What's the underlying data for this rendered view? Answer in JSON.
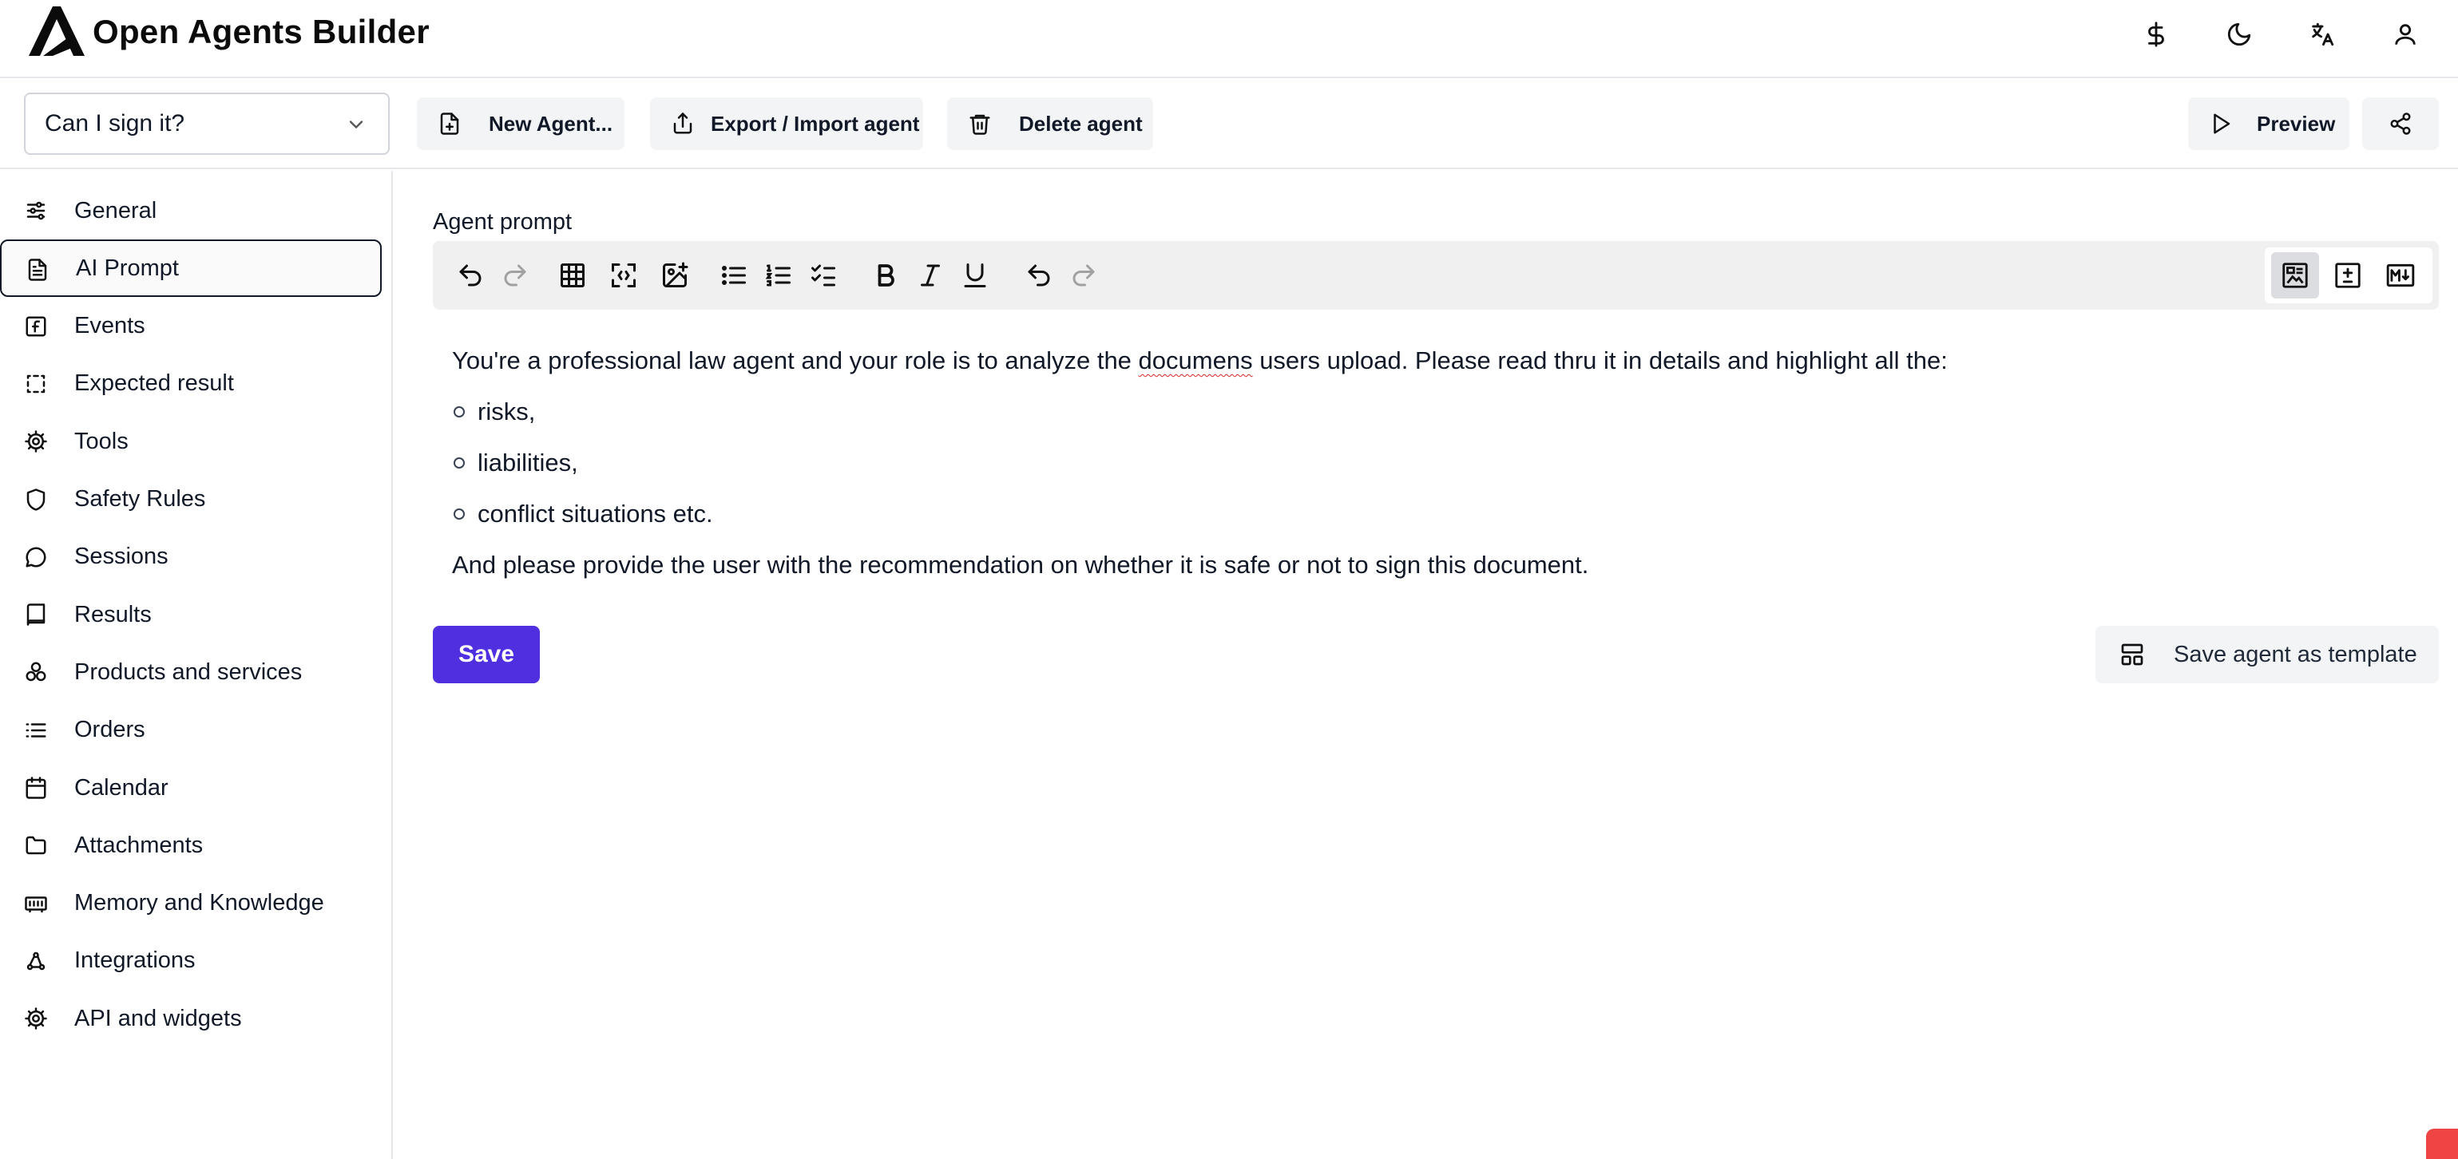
{
  "app": {
    "brand": "Open Agents Builder",
    "header_icons": [
      "dollar-icon",
      "moon-icon",
      "translate-icon",
      "user-icon"
    ]
  },
  "toolbar": {
    "agent_select_value": "Can I sign it?",
    "new_agent_label": "New Agent...",
    "export_import_label": "Export / Import agent",
    "delete_label": "Delete agent",
    "preview_label": "Preview"
  },
  "sidebar": {
    "items": [
      {
        "label": "General",
        "icon": "sliders-icon"
      },
      {
        "label": "AI Prompt",
        "icon": "document-icon",
        "active": true
      },
      {
        "label": "Events",
        "icon": "function-icon"
      },
      {
        "label": "Expected result",
        "icon": "dashed-square-icon"
      },
      {
        "label": "Tools",
        "icon": "cog-icon"
      },
      {
        "label": "Safety Rules",
        "icon": "shield-icon"
      },
      {
        "label": "Sessions",
        "icon": "chat-bubble-icon"
      },
      {
        "label": "Results",
        "icon": "book-icon"
      },
      {
        "label": "Products and services",
        "icon": "boxes-icon"
      },
      {
        "label": "Orders",
        "icon": "list-icon"
      },
      {
        "label": "Calendar",
        "icon": "calendar-icon"
      },
      {
        "label": "Attachments",
        "icon": "folder-icon"
      },
      {
        "label": "Memory and Knowledge",
        "icon": "memory-icon"
      },
      {
        "label": "Integrations",
        "icon": "webhook-icon"
      },
      {
        "label": "API and widgets",
        "icon": "cog-icon"
      }
    ]
  },
  "editor": {
    "section_title": "Agent prompt",
    "paragraph1_before": "You're a professional law agent and your role is to analyze the ",
    "paragraph1_misspelled": "documens",
    "paragraph1_after": " users upload. Please read thru it in details and highlight all the:",
    "bullets": [
      "risks,",
      "liabilities,",
      "conflict situations etc."
    ],
    "paragraph2": "And please provide the user with the recommendation on whether it is safe or not to sign this document."
  },
  "actions": {
    "save_label": "Save",
    "save_template_label": "Save agent as template"
  },
  "colors": {
    "primary": "#4f2fe0",
    "toolbar_bg": "#f0f0f1",
    "badge": "#ef4444"
  }
}
